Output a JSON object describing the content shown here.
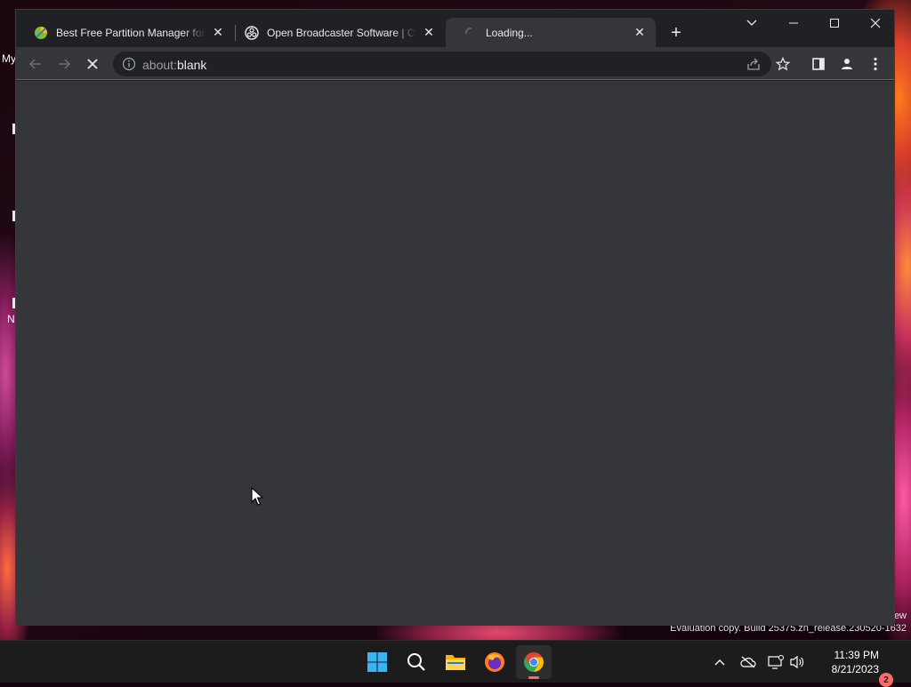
{
  "desktop": {
    "left_labels": [
      "My",
      "N"
    ],
    "watermark_top": "ew",
    "watermark": "Evaluation copy. Build 25375.zn_release.230520-1632"
  },
  "browser": {
    "tabs": [
      {
        "title": "Best Free Partition Manager for Windows",
        "favicon": "partition-wizard-icon",
        "active": false
      },
      {
        "title": "Open Broadcaster Software | OBS",
        "favicon": "obs-icon",
        "active": false
      },
      {
        "title": "Loading...",
        "favicon": "loading-spinner-icon",
        "active": true
      }
    ],
    "new_tab_label": "+",
    "address": {
      "scheme": "about:",
      "path": "blank"
    },
    "toolbar_icons": [
      "back-icon",
      "forward-icon",
      "stop-icon",
      "share-icon",
      "star-icon",
      "side-panel-icon",
      "profile-icon",
      "menu-icon"
    ]
  },
  "taskbar": {
    "apps": [
      "windows-start-icon",
      "search-icon",
      "file-explorer-icon",
      "firefox-icon",
      "chrome-icon"
    ],
    "active_app": "chrome-icon",
    "time": "11:39 PM",
    "date": "8/21/2023",
    "notification_count": "2"
  },
  "colors": {
    "accent": "#f26b6b",
    "chrome_dark": "#202124",
    "chrome_toolbar": "#35363a"
  }
}
